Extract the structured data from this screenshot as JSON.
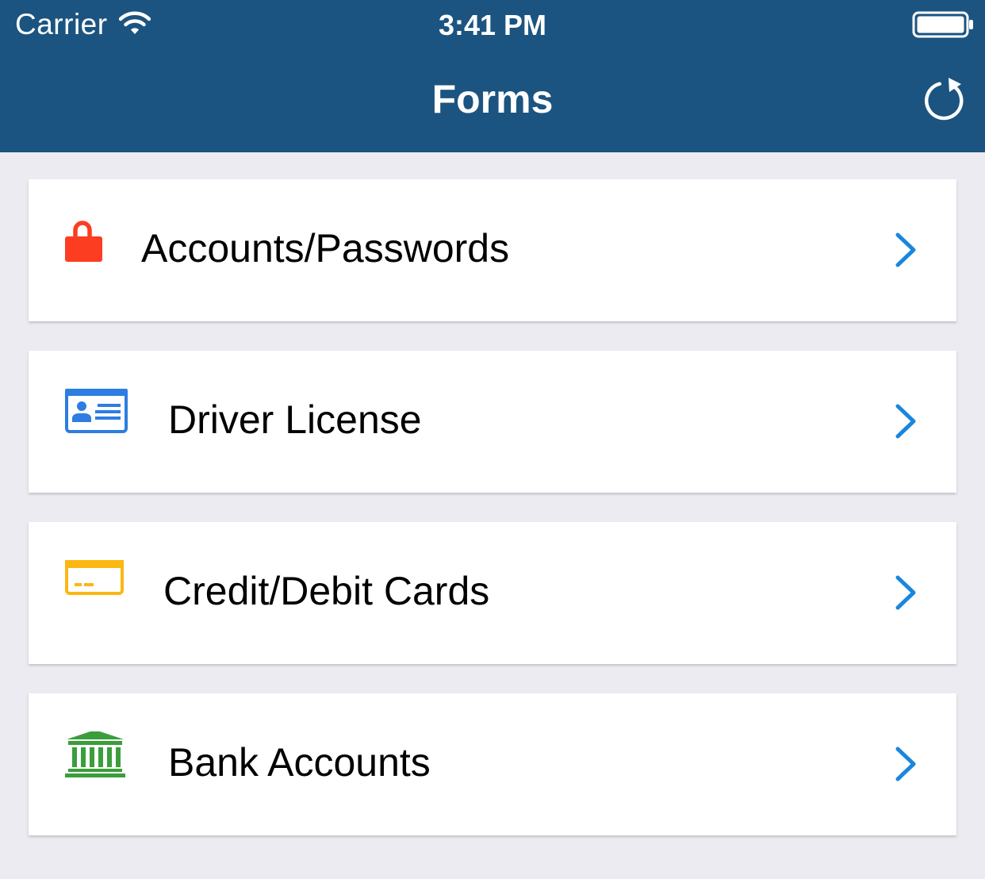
{
  "status_bar": {
    "carrier": "Carrier",
    "time": "3:41 PM",
    "wifi_icon": "wifi-icon",
    "battery_icon": "battery-full-icon"
  },
  "nav": {
    "title": "Forms",
    "refresh_icon": "refresh-icon",
    "background_color": "#1b5480"
  },
  "forms": {
    "items": [
      {
        "label": "Accounts/Passwords",
        "icon": "lock-icon",
        "icon_color": "#fc3d21"
      },
      {
        "label": "Driver License",
        "icon": "id-card-icon",
        "icon_color": "#2d7de2"
      },
      {
        "label": "Credit/Debit Cards",
        "icon": "credit-card-icon",
        "icon_color": "#fbb712"
      },
      {
        "label": "Bank Accounts",
        "icon": "bank-icon",
        "icon_color": "#3a9e3a"
      }
    ],
    "chevron_icon": "chevron-right-icon",
    "chevron_color": "#1a86dd"
  }
}
